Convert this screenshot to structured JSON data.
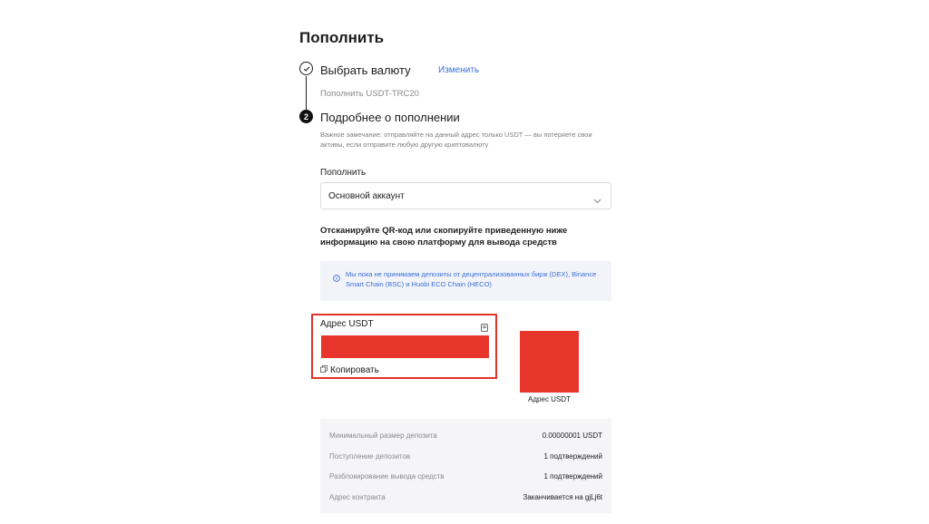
{
  "page": {
    "title": "Пополнить"
  },
  "step1": {
    "title": "Выбрать валюту",
    "change_link": "Изменить",
    "subtitle": "Пополнить USDT-TRC20"
  },
  "step2": {
    "number": "2",
    "title": "Подробнее о пополнении",
    "warning": "Важное замечание: отправляйте на данный адрес только USDT — вы потеряете свои активы, если отправите любую другую криптовалюту"
  },
  "deposit": {
    "label": "Пополнить",
    "account_value": "Основной аккаунт"
  },
  "scan_instruction": "Отсканируйте QR-код или скопируйте приведенную ниже информацию на свою платформу для вывода средств",
  "info_notice": "Мы пока не принимаем депозиты от децентрализованных бирж (DEX), Binance Smart Chain (BSC) и Huobi ECO Chain (HECO)",
  "address": {
    "label": "Адрес USDT",
    "copy_label": "Копировать"
  },
  "qr": {
    "caption": "Адрес USDT"
  },
  "details": [
    {
      "key": "Минимальный размер депозита",
      "value": "0.00000001 USDT"
    },
    {
      "key": "Поступление депозитов",
      "value": "1 подтверждений"
    },
    {
      "key": "Разблокирование вывода средств",
      "value": "1 подтверждений"
    },
    {
      "key": "Адрес контракта",
      "value": "Заканчивается на gjLj6t"
    }
  ],
  "colors": {
    "accent_blue": "#3a6fd8",
    "highlight_red": "#e0332a",
    "redaction_red": "#e8352c",
    "info_bg": "#f2f4f9"
  },
  "icons": {
    "step1": "check-circle-icon",
    "select": "chevron-down-icon",
    "info": "info-icon",
    "doc": "document-icon",
    "copy": "copy-icon"
  }
}
